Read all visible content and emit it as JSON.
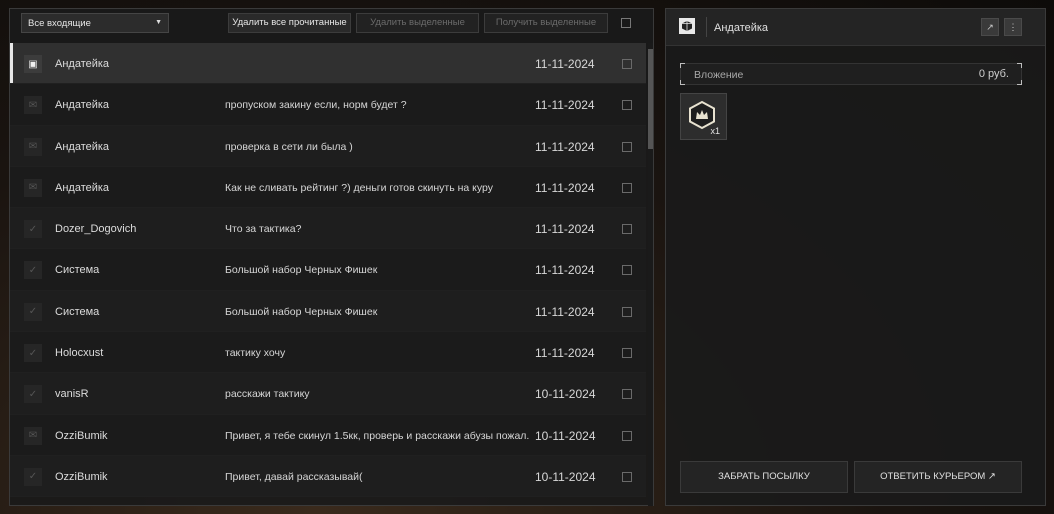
{
  "toolbar": {
    "filter_value": "Все входящие",
    "delete_read_label": "Удалить все прочитанные",
    "delete_selected_label": "Удалить выделенные",
    "get_selected_label": "Получить выделенные"
  },
  "messages": [
    {
      "icon": "parcel-icon",
      "sender": "Андатейка",
      "subject": "",
      "date": "11-11-2024",
      "selected": true
    },
    {
      "icon": "envelope-icon",
      "sender": "Андатейка",
      "subject": "пропуском закину если, норм будет ?",
      "date": "11-11-2024"
    },
    {
      "icon": "envelope-icon",
      "sender": "Андатейка",
      "subject": "проверка в сети ли была )",
      "date": "11-11-2024"
    },
    {
      "icon": "envelope-icon",
      "sender": "Андатейка",
      "subject": "Как не сливать рейтинг ?) деньги готов скинуть на куру",
      "date": "11-11-2024"
    },
    {
      "icon": "check-icon",
      "sender": "Dozer_Dogovich",
      "subject": "Что за тактика?",
      "date": "11-11-2024"
    },
    {
      "icon": "check-icon",
      "sender": "Система",
      "subject": "Большой набор Черных Фишек",
      "date": "11-11-2024"
    },
    {
      "icon": "check-icon",
      "sender": "Система",
      "subject": "Большой набор Черных Фишек",
      "date": "11-11-2024"
    },
    {
      "icon": "check-icon",
      "sender": "Holocxust",
      "subject": "тактику хочу",
      "date": "11-11-2024"
    },
    {
      "icon": "check-icon",
      "sender": "vanisR",
      "subject": "расскажи тактику",
      "date": "10-11-2024"
    },
    {
      "icon": "envelope-icon",
      "sender": "OzziBumik",
      "subject": "Привет, я тебе скинул 1.5кк, проверь и расскажи абузы пожал..",
      "date": "10-11-2024"
    },
    {
      "icon": "check-icon",
      "sender": "OzziBumik",
      "subject": "Привет, давай рассказывай(",
      "date": "10-11-2024"
    }
  ],
  "detail": {
    "sender": "Андатейка",
    "attachment_label": "Вложение",
    "attachment_value": "0 руб.",
    "item_quantity": "x1",
    "take_parcel_label": "ЗАБРАТЬ ПОСЫЛКУ",
    "reply_courier_label": "ОТВЕТИТЬ КУРЬЕРОМ ↗"
  }
}
